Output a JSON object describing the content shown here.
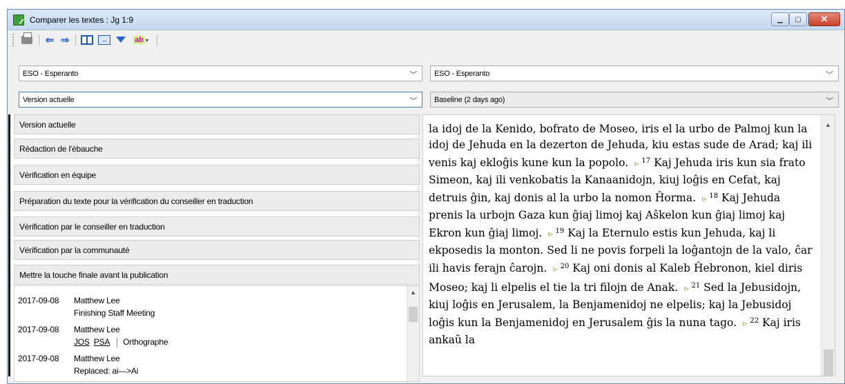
{
  "window": {
    "title": "Comparer les textes : Jg 1:9"
  },
  "toolbar": {
    "print": "printer-icon",
    "back": "arrow-left-icon",
    "forward": "arrow-right-icon",
    "side_by_side": "book-icon",
    "columns": "columns-icon",
    "filter": "filter-icon",
    "highlight_label": "ab"
  },
  "left": {
    "language": "ESO - Esperanto",
    "version": "Version actuelle",
    "stages": [
      "Version actuelle",
      "Rédaction de l'ébauche",
      "Vérification en équipe",
      "Préparation du texte pour la vérification du conseiller en traduction",
      "Vérification par le conseiller en traduction",
      "Vérification par la communauté",
      "Mettre la touche finale avant la publication"
    ],
    "notes": [
      {
        "date": "2017-09-08",
        "author": "Matthew Lee",
        "detail": "Finishing Staff Meeting"
      },
      {
        "date": "2017-09-08",
        "author": "Matthew Lee",
        "tags": [
          "JOS",
          "PSA"
        ],
        "category": "Orthographe"
      },
      {
        "date": "2017-09-08",
        "author": "Matthew Lee",
        "detail": "Replaced: ai—>Ai"
      }
    ]
  },
  "right": {
    "language": "ESO - Esperanto",
    "version": "Baseline (2 days ago)",
    "verses": [
      {
        "num": "",
        "text": "la idoj de la Kenido, bofrato de Moseo, iris el la urbo de Palmoj kun la idoj de Jehuda en la dezerton de Jehuda, kiu estas sude de Arad; kaj ili venis kaj ekloĝis kune kun la popolo."
      },
      {
        "num": "17",
        "text": "Kaj Jehuda iris kun sia frato Simeon, kaj ili venkobatis la Kanaanidojn, kiuj loĝis en Cefat, kaj detruis ĝin, kaj donis al la urbo la nomon Ĥorma."
      },
      {
        "num": "18",
        "text": "Kaj Jehuda prenis la urbojn Gaza kun ĝiaj limoj kaj Aŝkelon kun ĝiaj limoj kaj Ekron kun ĝiaj limoj."
      },
      {
        "num": "19",
        "text": "Kaj la Eternulo estis kun Jehuda, kaj li ekposedis la monton. Sed li ne povis forpeli la loĝantojn de la valo, ĉar ili havis ferajn ĉarojn."
      },
      {
        "num": "20",
        "text": "Kaj oni donis al Kaleb Ĥebronon, kiel diris Moseo; kaj li elpelis el tie la tri filojn de Anak."
      },
      {
        "num": "21",
        "text": "Sed la Jebusidojn, kiuj loĝis en Jerusalem, la Benjamenidoj ne elpelis; kaj la Jebusidoj loĝis kun la Benjamenidoj en Jerusalem ĝis la nuna tago."
      },
      {
        "num": "22",
        "text": "Kaj iris ankaŭ la"
      }
    ]
  }
}
